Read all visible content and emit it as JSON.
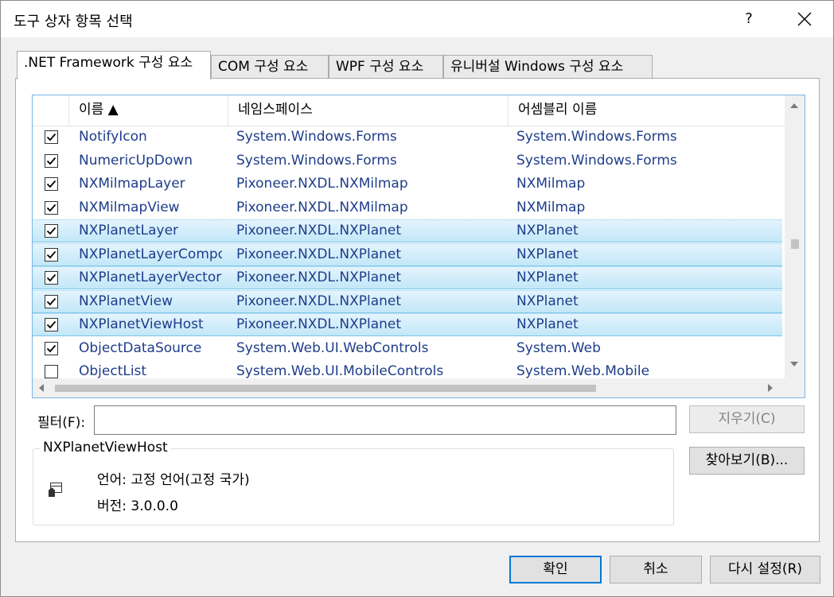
{
  "window": {
    "title": "도구 상자 항목 선택",
    "help_label": "?"
  },
  "tabs": [
    {
      "label": ".NET Framework 구성 요소",
      "active": true
    },
    {
      "label": "COM 구성 요소",
      "active": false
    },
    {
      "label": "WPF 구성 요소",
      "active": false
    },
    {
      "label": "유니버설 Windows 구성 요소",
      "active": false
    }
  ],
  "list": {
    "columns": [
      "이름 ▲",
      "네임스페이스",
      "어셈블리 이름"
    ],
    "rows": [
      {
        "checked": true,
        "name": "NotifyIcon",
        "namespace": "System.Windows.Forms",
        "assembly": "System.Windows.Forms",
        "selected": false
      },
      {
        "checked": true,
        "name": "NumericUpDown",
        "namespace": "System.Windows.Forms",
        "assembly": "System.Windows.Forms",
        "selected": false
      },
      {
        "checked": true,
        "name": "NXMilmapLayer",
        "namespace": "Pixoneer.NXDL.NXMilmap",
        "assembly": "NXMilmap",
        "selected": false
      },
      {
        "checked": true,
        "name": "NXMilmapView",
        "namespace": "Pixoneer.NXDL.NXMilmap",
        "assembly": "NXMilmap",
        "selected": false
      },
      {
        "checked": true,
        "name": "NXPlanetLayer",
        "namespace": "Pixoneer.NXDL.NXPlanet",
        "assembly": "NXPlanet",
        "selected": true
      },
      {
        "checked": true,
        "name": "NXPlanetLayerCompo",
        "namespace": "Pixoneer.NXDL.NXPlanet",
        "assembly": "NXPlanet",
        "selected": true
      },
      {
        "checked": true,
        "name": "NXPlanetLayerVectorE",
        "namespace": "Pixoneer.NXDL.NXPlanet",
        "assembly": "NXPlanet",
        "selected": true
      },
      {
        "checked": true,
        "name": "NXPlanetView",
        "namespace": "Pixoneer.NXDL.NXPlanet",
        "assembly": "NXPlanet",
        "selected": true
      },
      {
        "checked": true,
        "name": "NXPlanetViewHost",
        "namespace": "Pixoneer.NXDL.NXPlanet",
        "assembly": "NXPlanet",
        "selected": true
      },
      {
        "checked": true,
        "name": "ObjectDataSource",
        "namespace": "System.Web.UI.WebControls",
        "assembly": "System.Web",
        "selected": false
      },
      {
        "checked": false,
        "name": "ObjectList",
        "namespace": "System.Web.UI.MobileControls",
        "assembly": "System.Web.Mobile",
        "selected": false
      }
    ]
  },
  "filter": {
    "label": "필터(F):",
    "value": "",
    "clear_label": "지우기(C)"
  },
  "details": {
    "title": "NXPlanetViewHost",
    "language_line": "언어: 고정 언어(고정 국가)",
    "version_line": "버전: 3.0.0.0"
  },
  "buttons": {
    "browse": "찾아보기(B)...",
    "ok": "확인",
    "cancel": "취소",
    "reset": "다시 설정(R)"
  },
  "colors": {
    "selection_top": "#e4f4fd",
    "selection_bottom": "#c2e7f8",
    "link_text": "#1e3d8a",
    "accent": "#0078d7"
  }
}
